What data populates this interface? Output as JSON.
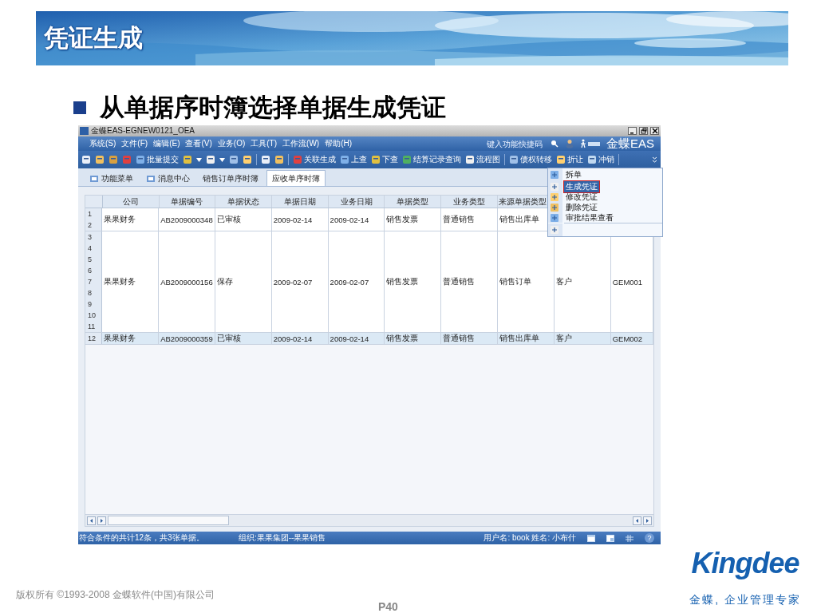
{
  "slide": {
    "title": "凭证生成",
    "heading": "从单据序时簿选择单据生成凭证",
    "copyright": "版权所有 ©1993-2008 金蝶软件(中国)有限公司",
    "page": "P40",
    "brand": "Kingdee",
    "tagline": "金蝶, 企业管理专家"
  },
  "window": {
    "title": "金蝶EAS-EGNEW0121_OEA",
    "menu": [
      "系统(S)",
      "文件(F)",
      "编辑(E)",
      "查看(V)",
      "业务(O)",
      "工具(T)",
      "工作流(W)",
      "帮助(H)"
    ],
    "quick_code": {
      "placeholder": "键入功能快捷码"
    },
    "product": "金蝶EAS"
  },
  "toolbar": [
    {
      "kind": "icon"
    },
    {
      "kind": "icon"
    },
    {
      "kind": "icon"
    },
    {
      "kind": "icon"
    },
    {
      "kind": "button",
      "label": "批量提交"
    },
    {
      "kind": "icon"
    },
    {
      "kind": "caret"
    },
    {
      "kind": "icon"
    },
    {
      "kind": "caret"
    },
    {
      "kind": "icon"
    },
    {
      "kind": "icon"
    },
    {
      "kind": "separator"
    },
    {
      "kind": "icon"
    },
    {
      "kind": "icon"
    },
    {
      "kind": "separator"
    },
    {
      "kind": "button",
      "label": "关联生成"
    },
    {
      "kind": "button",
      "label": "上查"
    },
    {
      "kind": "button",
      "label": "下查"
    },
    {
      "kind": "button",
      "label": "结算记录查询"
    },
    {
      "kind": "button",
      "label": "流程图"
    },
    {
      "kind": "separator"
    },
    {
      "kind": "button",
      "label": "债权转移"
    },
    {
      "kind": "button",
      "label": "折让"
    },
    {
      "kind": "button",
      "label": "冲销"
    },
    {
      "kind": "separator"
    },
    {
      "kind": "overflow"
    }
  ],
  "tabs": [
    {
      "label": "功能菜单",
      "kind": "icon",
      "selected": false
    },
    {
      "label": "消息中心",
      "kind": "icon",
      "selected": false
    },
    {
      "label": "销售订单序时簿",
      "kind": "plain",
      "selected": false
    },
    {
      "label": "应收单序时簿",
      "kind": "plain",
      "selected": true
    }
  ],
  "table": {
    "columns": [
      "公司",
      "单据编号",
      "单据状态",
      "单据日期",
      "业务日期",
      "单据类型",
      "业务类型",
      "来源单据类型"
    ],
    "rows": [
      {
        "numbers": [
          "1",
          "2"
        ],
        "cells": [
          "果果财务",
          "AB2009000348",
          "已审核",
          "2009-02-14",
          "2009-02-14",
          "销售发票",
          "普通销售",
          "销售出库单"
        ],
        "selected": false
      },
      {
        "numbers": [
          "3",
          "4",
          "5",
          "6",
          "7",
          "8",
          "9",
          "10",
          "11"
        ],
        "cells": [
          "果果财务",
          "AB2009000156",
          "保存",
          "2009-02-07",
          "2009-02-07",
          "销售发票",
          "普通销售",
          "销售订单",
          "客户",
          "GEM001"
        ],
        "selected": false
      },
      {
        "numbers": [
          "12"
        ],
        "cells": [
          "果果财务",
          "AB2009000359",
          "已审核",
          "2009-02-14",
          "2009-02-14",
          "销售发票",
          "普通销售",
          "销售出库单",
          "客户",
          "GEM002"
        ],
        "selected": true
      }
    ]
  },
  "context_menu": [
    {
      "kind": "item",
      "label": "拆单",
      "selected": false
    },
    {
      "kind": "item",
      "label": "生成凭证",
      "selected": true
    },
    {
      "kind": "item",
      "label": "修改凭证",
      "selected": false
    },
    {
      "kind": "item",
      "label": "删除凭证",
      "selected": false
    },
    {
      "kind": "item",
      "label": "审批结果查看",
      "selected": false
    },
    {
      "kind": "blank"
    }
  ],
  "status_bar": {
    "summary": "符合条件的共计12条，共3张单据。",
    "organization": "组织:果果集团--果果销售",
    "user": "用户名: book 姓名: 小布什",
    "help": "?"
  }
}
